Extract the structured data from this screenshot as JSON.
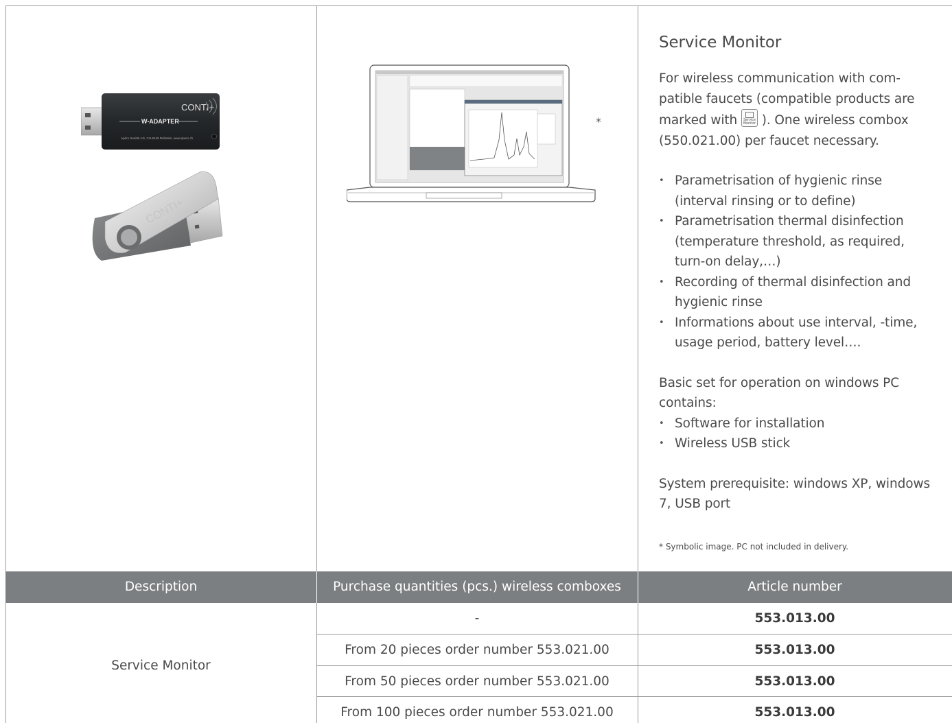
{
  "product": {
    "asterisk": "*",
    "title": "Service Monitor",
    "intro_part1": "For wireless communication with com-patible faucets (compatible products are marked with",
    "intro_part2": "). One wireless combox (550.021.00) per faucet necessary.",
    "icon_text": "Service Monitor",
    "features": [
      "Parametrisation of hygienic rinse (interval rinsing or to define)",
      "Parametrisation thermal disinfection (temperature threshold, as required, turn-on delay,…)",
      "Recording of thermal disinfection and hygienic rinse",
      "Informations about use interval, -time, usage period, battery level…."
    ],
    "basic_set_intro": "Basic set for operation on windows PC contains:",
    "basic_set_items": [
      "Software for installation",
      "Wireless USB stick"
    ],
    "prerequisite": "System prerequisite: windows XP, windows 7, USB port",
    "footnote": "* Symbolic image. PC not included in delivery.",
    "adapter_label": "CONTI+",
    "adapter_sub": "W-ADAPTER",
    "adapter_small": "Apéro Sanitär AG, CH-9445 Rebstein, www.apero.ch",
    "stick_label": "CONTI+"
  },
  "table": {
    "headers": [
      "Description",
      "Purchase quantities (pcs.) wireless comboxes",
      "Article number"
    ],
    "description": "Service Monitor",
    "rows": [
      {
        "quantity": "-",
        "article": "553.013.00"
      },
      {
        "quantity": "From 20 pieces order number 553.021.00",
        "article": "553.013.00"
      },
      {
        "quantity": "From 50 pieces order number 553.021.00",
        "article": "553.013.00"
      },
      {
        "quantity": "From 100 pieces order number 553.021.00",
        "article": "553.013.00"
      }
    ]
  }
}
